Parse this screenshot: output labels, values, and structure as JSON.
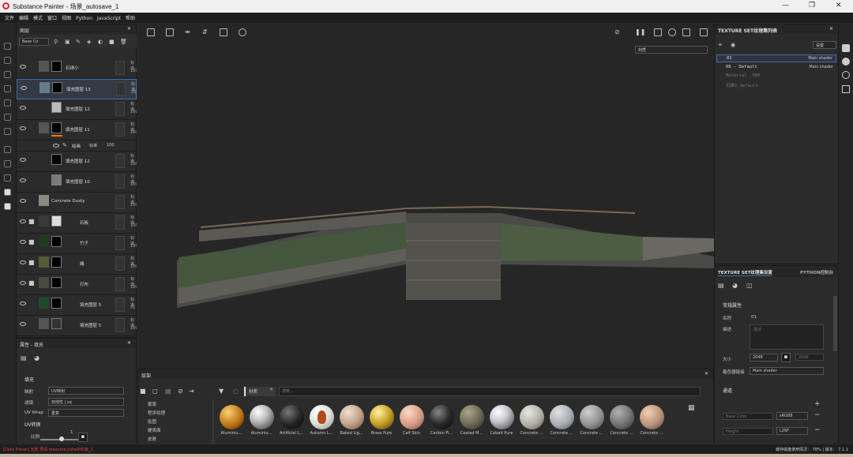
{
  "window": {
    "title": "Substance Painter - 场景_autosave_1",
    "min": "—",
    "max": "❐",
    "close": "✕"
  },
  "menu": [
    "文件",
    "编辑",
    "模式",
    "窗口",
    "视图",
    "Python",
    "JavaScript",
    "帮助"
  ],
  "layers_panel": {
    "title": "图层",
    "channel": "Base Co",
    "rows": [
      {
        "name": "石锈小",
        "mode": "标准",
        "opacity": "100"
      },
      {
        "name": "填充图层 13",
        "mode": "标准",
        "opacity": "100"
      },
      {
        "name": "填充图层 12",
        "mode": "标准",
        "opacity": "100"
      },
      {
        "name": "填充图层 11",
        "mode": "标准",
        "opacity": "100"
      },
      {
        "name": "绘画",
        "mode": "标准",
        "opacity": "100"
      },
      {
        "name": "填充图层 12",
        "mode": "标准",
        "opacity": "100"
      },
      {
        "name": "填充图层 10",
        "mode": "标准",
        "opacity": "100"
      },
      {
        "name": "Concrete Dusty",
        "mode": "标准",
        "opacity": "100"
      },
      {
        "name": "石板",
        "mode": "标准",
        "opacity": "100"
      },
      {
        "name": "竹子",
        "mode": "标准",
        "opacity": "100"
      },
      {
        "name": "绳",
        "mode": "标准",
        "opacity": "100"
      },
      {
        "name": "灯布",
        "mode": "标准",
        "opacity": "100"
      },
      {
        "name": "填充图层 5",
        "mode": "标准",
        "opacity": "51"
      },
      {
        "name": "填充图层 5",
        "mode": "标准",
        "opacity": "100"
      }
    ]
  },
  "props_panel": {
    "title": "属性 - 填充",
    "section": "填充",
    "rows": [
      {
        "label": "映射",
        "value": "UV映射"
      },
      {
        "label": "滤镜",
        "value": "双线性 | sq"
      },
      {
        "label": "UV Wrap",
        "value": "重复"
      }
    ],
    "uv_section": "UV转换",
    "scale_label": "比例",
    "scale_value": "1"
  },
  "viewport": {
    "view_mode": "材质"
  },
  "texset_list": {
    "title": "TEXTURE SET纹理集列表",
    "settings": "设置",
    "items": [
      {
        "name": "01",
        "shader": "Main shader"
      },
      {
        "name": "08 - Default",
        "shader": "Main shader"
      },
      {
        "name": "Material _300",
        "shader": ""
      },
      {
        "name": "石狮1_default",
        "shader": ""
      }
    ]
  },
  "texset_props": {
    "tab1": "TEXTURE SET纹理集设置",
    "tab2": "PYTHON控制台",
    "section": "常规属性",
    "name_label": "名称",
    "name_value": "01",
    "desc_label": "描述",
    "desc_placeholder": "描述",
    "size_label": "大小",
    "size_value": "2048",
    "size_value2": "2048",
    "shader_label": "着色器链接",
    "shader_value": "Main shader",
    "channels_section": "通道",
    "channels": [
      {
        "name": "Base Color",
        "format": "sRGB8"
      },
      {
        "name": "Height",
        "format": "L16F"
      }
    ]
  },
  "shelf": {
    "title": "层架",
    "filter_tag": "材质",
    "search_placeholder": "搜索...",
    "categories": [
      "蒙版",
      "程序纹理",
      "贴图",
      "硬表面",
      "皮肤",
      "滤镜"
    ],
    "materials": [
      "Aluminiu...",
      "Aluminiu...",
      "Artificial L...",
      "Autumn L...",
      "Baked Lig...",
      "Brass Pure",
      "Calf Skin",
      "Carbon Fi...",
      "Coated M...",
      "Cobalt Pure",
      "Concrete ...",
      "Concrete ...",
      "Concrete ...",
      "Concrete ...",
      "Concrete ..."
    ]
  },
  "status": {
    "left": "[Data Preset] 无效 预设 resource://shelf/石板_1",
    "right": "缓存磁盘使用情况：  78%  | 版本：  7.1.1"
  }
}
